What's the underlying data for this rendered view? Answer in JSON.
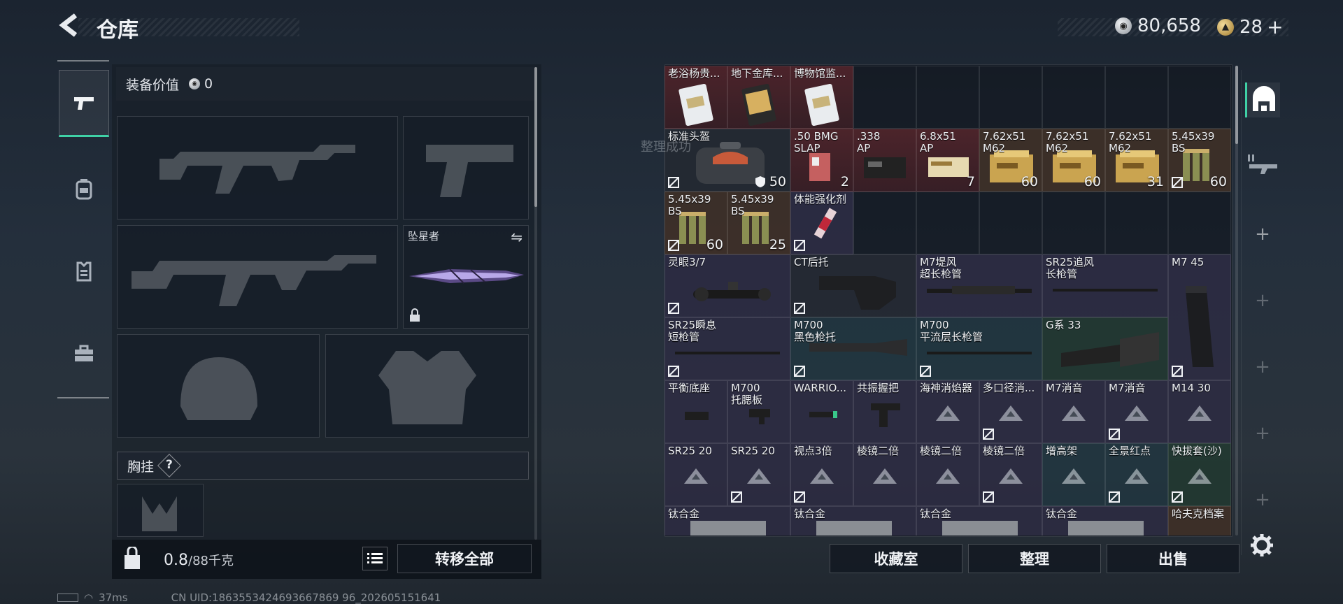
{
  "header": {
    "title": "仓库",
    "currency_silver": "80,658",
    "currency_gold": "28",
    "add_label": "+"
  },
  "equipment": {
    "value_label": "装备价值",
    "value": "0",
    "melee_name": "坠星者",
    "chest_rig_label": "胸挂",
    "help_label": "?"
  },
  "footer_left": {
    "weight_current": "0.8",
    "weight_max": "/88千克",
    "transfer_all_label": "转移全部"
  },
  "stash_items": [
    {
      "name": "老浴杨贵...",
      "count": ""
    },
    {
      "name": "地下金库...",
      "count": ""
    },
    {
      "name": "博物馆监...",
      "count": ""
    },
    {
      "name": "标准头盔",
      "count": "50"
    },
    {
      "name": ".50 BMG\nSLAP",
      "count": "2"
    },
    {
      "name": ".338\nAP",
      "count": ""
    },
    {
      "name": "6.8x51\nAP",
      "count": "7"
    },
    {
      "name": "7.62x51\nM62",
      "count": "60"
    },
    {
      "name": "7.62x51\nM62",
      "count": "60"
    },
    {
      "name": "7.62x51\nM62",
      "count": "31"
    },
    {
      "name": "5.45x39\nBS",
      "count": "60"
    },
    {
      "name": "5.45x39\nBS",
      "count": "60"
    },
    {
      "name": "5.45x39\nBS",
      "count": "25"
    },
    {
      "name": "体能强化剂",
      "count": ""
    },
    {
      "name": "灵眼3/7",
      "count": ""
    },
    {
      "name": "CT后托",
      "count": ""
    },
    {
      "name": "M7堤风\n超长枪管",
      "count": ""
    },
    {
      "name": "SR25追风\n长枪管",
      "count": ""
    },
    {
      "name": "M7 45",
      "count": ""
    },
    {
      "name": "SR25瞬息\n短枪管",
      "count": ""
    },
    {
      "name": "M700\n黑色枪托",
      "count": ""
    },
    {
      "name": "M700\n平流层长枪管",
      "count": ""
    },
    {
      "name": "G系 33",
      "count": ""
    },
    {
      "name": "平衡底座",
      "count": ""
    },
    {
      "name": "M700\n托腮板",
      "count": ""
    },
    {
      "name": "WARRIO...",
      "count": ""
    },
    {
      "name": "共振握把",
      "count": ""
    },
    {
      "name": "海神消焰器",
      "count": ""
    },
    {
      "name": "多口径消...",
      "count": ""
    },
    {
      "name": "M7消音",
      "count": ""
    },
    {
      "name": "M7消音",
      "count": ""
    },
    {
      "name": "M14 30",
      "count": ""
    },
    {
      "name": "SR25 20",
      "count": ""
    },
    {
      "name": "SR25 20",
      "count": ""
    },
    {
      "name": "视点3倍",
      "count": ""
    },
    {
      "name": "棱镜二倍",
      "count": ""
    },
    {
      "name": "棱镜二倍",
      "count": ""
    },
    {
      "name": "棱镜二倍",
      "count": ""
    },
    {
      "name": "增高架",
      "count": ""
    },
    {
      "name": "全景红点",
      "count": ""
    },
    {
      "name": "快拔套(沙)",
      "count": ""
    },
    {
      "name": "钛合金",
      "count": ""
    },
    {
      "name": "钛合金",
      "count": ""
    },
    {
      "name": "钛合金",
      "count": ""
    },
    {
      "name": "钛合金",
      "count": ""
    },
    {
      "name": "哈夫克档案",
      "count": ""
    }
  ],
  "overlay_text": "整理成功",
  "footer_right": {
    "collection_label": "收藏室",
    "sort_label": "整理",
    "sell_label": "出售"
  },
  "status_bar": {
    "ping": "37ms",
    "uid": "CN UID:1863553424693667869 96_202605151641"
  },
  "colors": {
    "accent_green": "#3fd1a6",
    "rarity_red": "#7a2a30",
    "rarity_purple": "#3a3454",
    "rarity_teal": "#284650",
    "rarity_green": "#284637"
  },
  "icons": [
    "back-arrow-icon",
    "silver-coin-icon",
    "gold-coin-icon",
    "pistol-icon",
    "backpack-icon",
    "armor-icon",
    "toolbox-icon",
    "swap-icon",
    "lock-icon",
    "help-icon",
    "list-icon",
    "weight-icon",
    "helmet-tab-icon",
    "weapon-tab-icon",
    "gear-icon",
    "wifi-icon",
    "battery-icon"
  ]
}
